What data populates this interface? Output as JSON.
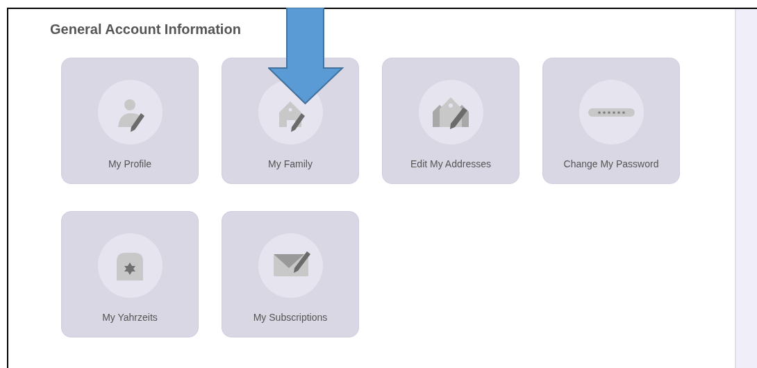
{
  "section": {
    "title": "General Account Information"
  },
  "tiles": [
    {
      "label": "My Profile"
    },
    {
      "label": "My Family"
    },
    {
      "label": "Edit My Addresses"
    },
    {
      "label": "Change My Password"
    },
    {
      "label": "My Yahrzeits"
    },
    {
      "label": "My Subscriptions"
    }
  ]
}
